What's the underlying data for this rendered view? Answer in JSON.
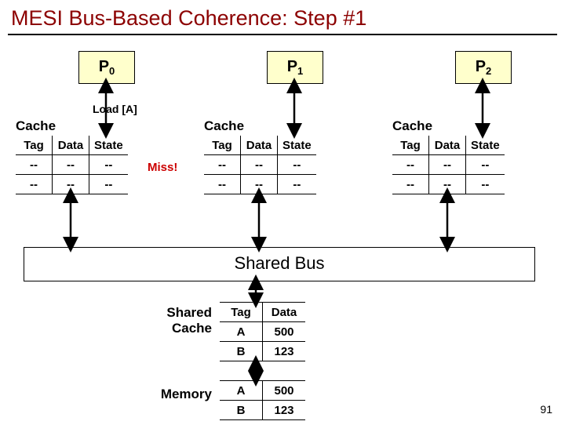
{
  "title": "MESI Bus-Based Coherence: Step #1",
  "processors": {
    "p0": {
      "letter": "P",
      "sub": "0"
    },
    "p1": {
      "letter": "P",
      "sub": "1"
    },
    "p2": {
      "letter": "P",
      "sub": "2"
    }
  },
  "load_label": "Load [A]",
  "cache_label": "Cache",
  "cache_headers": {
    "tag": "Tag",
    "data": "Data",
    "state": "State"
  },
  "cache0_rows": [
    {
      "tag": "--",
      "data": "--",
      "state": "--"
    },
    {
      "tag": "--",
      "data": "--",
      "state": "--"
    }
  ],
  "cache1_rows": [
    {
      "tag": "--",
      "data": "--",
      "state": "--"
    },
    {
      "tag": "--",
      "data": "--",
      "state": "--"
    }
  ],
  "cache2_rows": [
    {
      "tag": "--",
      "data": "--",
      "state": "--"
    },
    {
      "tag": "--",
      "data": "--",
      "state": "--"
    }
  ],
  "miss_label": "Miss!",
  "bus_label": "Shared Bus",
  "shared_cache_label_line1": "Shared",
  "shared_cache_label_line2": "Cache",
  "shared_cache_headers": {
    "tag": "Tag",
    "data": "Data"
  },
  "shared_cache_rows": [
    {
      "tag": "A",
      "data": "500"
    },
    {
      "tag": "B",
      "data": "123"
    }
  ],
  "memory_label": "Memory",
  "memory_rows": [
    {
      "tag": "A",
      "data": "500"
    },
    {
      "tag": "B",
      "data": "123"
    }
  ],
  "slide_number": "91"
}
